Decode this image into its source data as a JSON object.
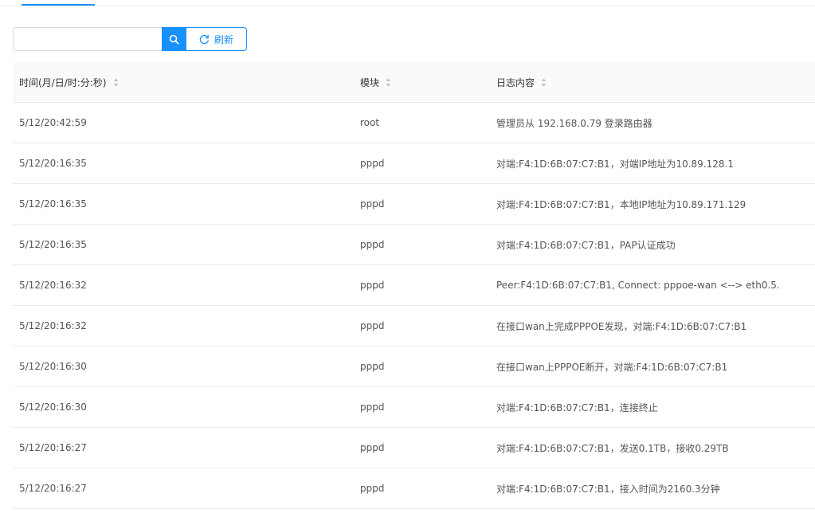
{
  "search": {
    "value": "",
    "placeholder": ""
  },
  "toolbar": {
    "search_icon": "search-icon",
    "refresh_icon": "refresh-icon",
    "refresh_label": "刷新"
  },
  "table": {
    "columns": [
      {
        "label": "时间(月/日/时:分:秒)"
      },
      {
        "label": "模块"
      },
      {
        "label": "日志内容"
      }
    ],
    "rows": [
      {
        "time": "5/12/20:42:59",
        "module": "root",
        "content": "管理员从 192.168.0.79 登录路由器"
      },
      {
        "time": "5/12/20:16:35",
        "module": "pppd",
        "content": "对端:F4:1D:6B:07:C7:B1，对端IP地址为10.89.128.1"
      },
      {
        "time": "5/12/20:16:35",
        "module": "pppd",
        "content": "对端:F4:1D:6B:07:C7:B1，本地IP地址为10.89.171.129"
      },
      {
        "time": "5/12/20:16:35",
        "module": "pppd",
        "content": "对端:F4:1D:6B:07:C7:B1，PAP认证成功"
      },
      {
        "time": "5/12/20:16:32",
        "module": "pppd",
        "content": "Peer:F4:1D:6B:07:C7:B1, Connect: pppoe-wan <--> eth0.5."
      },
      {
        "time": "5/12/20:16:32",
        "module": "pppd",
        "content": "在接口wan上完成PPPOE发现，对端:F4:1D:6B:07:C7:B1"
      },
      {
        "time": "5/12/20:16:30",
        "module": "pppd",
        "content": "在接口wan上PPPOE断开，对端:F4:1D:6B:07:C7:B1"
      },
      {
        "time": "5/12/20:16:30",
        "module": "pppd",
        "content": "对端:F4:1D:6B:07:C7:B1，连接终止"
      },
      {
        "time": "5/12/20:16:27",
        "module": "pppd",
        "content": "对端:F4:1D:6B:07:C7:B1，发送0.1TB，接收0.29TB"
      },
      {
        "time": "5/12/20:16:27",
        "module": "pppd",
        "content": "对端:F4:1D:6B:07:C7:B1，接入时间为2160.3分钟"
      }
    ]
  },
  "colors": {
    "accent": "#1890ff",
    "header_bg": "#fafafa",
    "border": "#ebebeb",
    "text": "#555555"
  }
}
